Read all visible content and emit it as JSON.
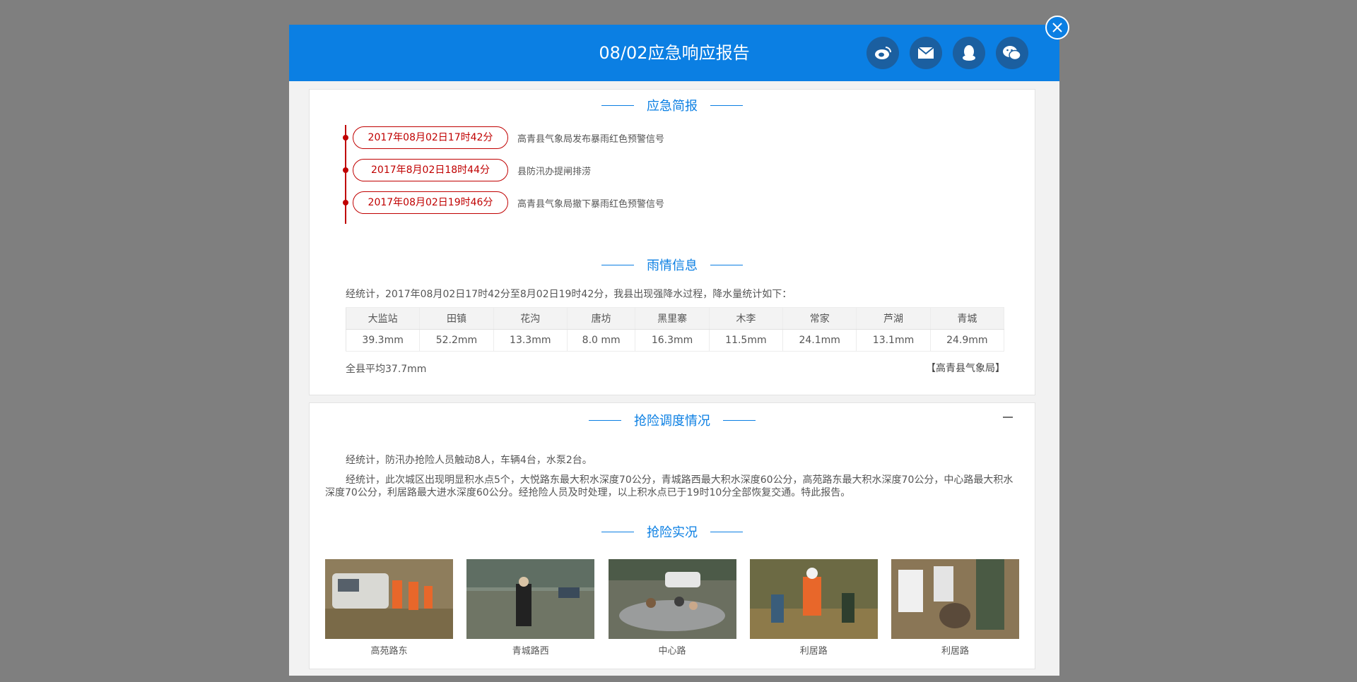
{
  "modal": {
    "title": "08/02应急响应报告",
    "share": [
      {
        "icon": "weibo-icon"
      },
      {
        "icon": "email-icon"
      },
      {
        "icon": "qq-icon"
      },
      {
        "icon": "wechat-icon"
      }
    ],
    "close_icon": "close-icon"
  },
  "brief": {
    "title": "应急简报",
    "items": [
      {
        "time": "2017年08月02日17时42分",
        "text": "高青县气象局发布暴雨红色预警信号"
      },
      {
        "time": "2017年8月02日18时44分",
        "text": "县防汛办提闸排涝"
      },
      {
        "time": "2017年08月02日19时46分",
        "text": "高青县气象局撤下暴雨红色预警信号"
      }
    ]
  },
  "rain": {
    "title": "雨情信息",
    "desc": "经统计，2017年08月02日17时42分至8月02日19时42分，我县出现强降水过程，降水量统计如下：",
    "stations": [
      "大监站",
      "田镇",
      "花沟",
      "唐坊",
      "黑里寨",
      "木李",
      "常家",
      "芦湖",
      "青城"
    ],
    "values": [
      "39.3mm",
      "52.2mm",
      "13.3mm",
      "8.0 mm",
      "16.3mm",
      "11.5mm",
      "24.1mm",
      "13.1mm",
      "24.9mm"
    ],
    "average": "全县平均37.7mm",
    "source": "【高青县气象局】"
  },
  "dispatch": {
    "title": "抢险调度情况",
    "para1": "经统计，防汛办抢险人员触动8人，车辆4台，水泵2台。",
    "para2": "经统计，此次城区出现明显积水点5个，大悦路东最大积水深度70公分，青城路西最大积水深度60公分，高苑路东最大积水深度70公分，中心路最大积水深度70公分，利居路最大进水深度60公分。经抢险人员及时处理，以上积水点已于19时10分全部恢复交通。特此报告。"
  },
  "photos": {
    "title": "抢险实况",
    "items": [
      {
        "caption": "高苑路东"
      },
      {
        "caption": "青城路西"
      },
      {
        "caption": "中心路"
      },
      {
        "caption": "利居路"
      },
      {
        "caption": "利居路"
      }
    ]
  }
}
